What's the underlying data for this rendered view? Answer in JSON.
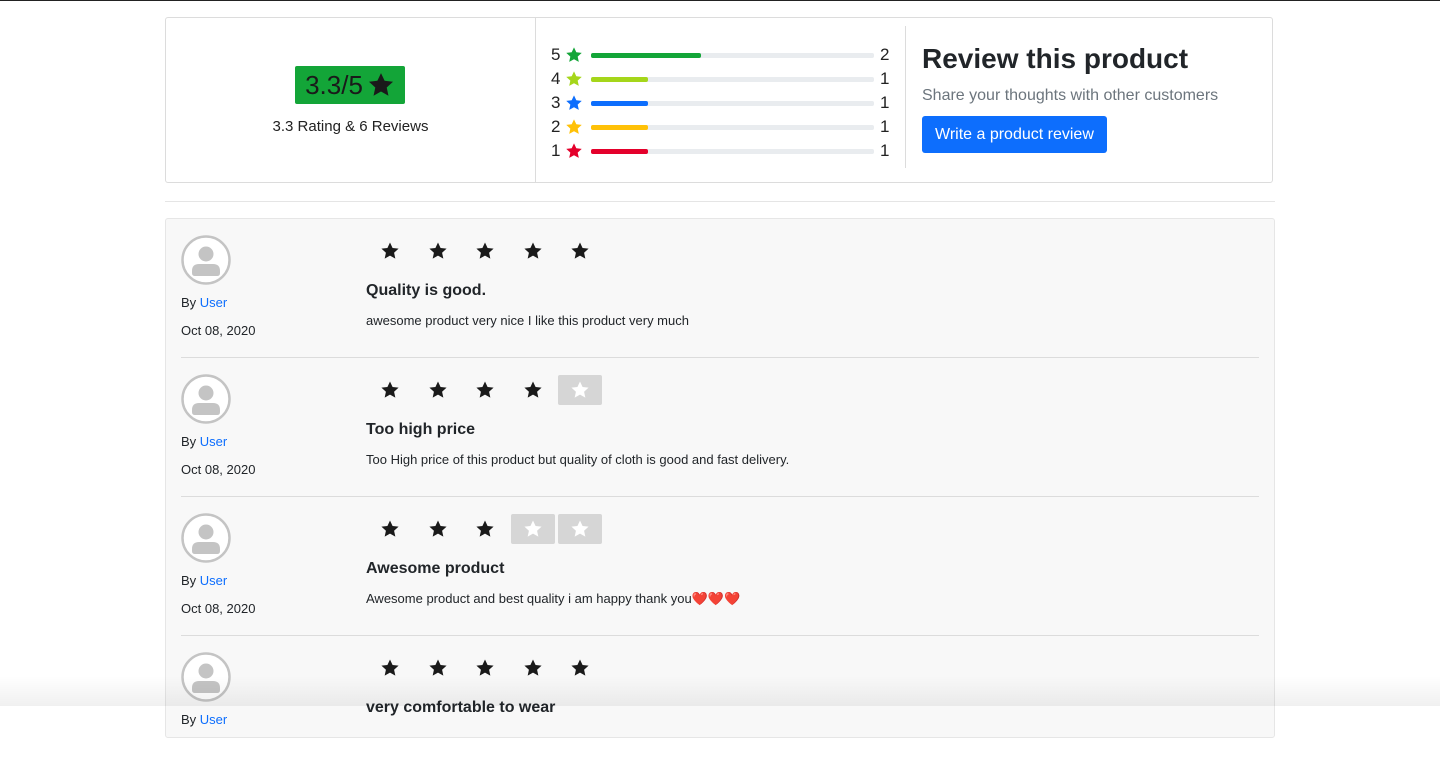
{
  "summary": {
    "score": "3.3/5",
    "caption": "3.3 Rating & 6 Reviews",
    "badge_color": "#13a538"
  },
  "distribution": [
    {
      "stars": "5",
      "count": "2",
      "fraction": 0.39,
      "color": "#13a538"
    },
    {
      "stars": "4",
      "count": "1",
      "fraction": 0.2,
      "color": "#a5d61a"
    },
    {
      "stars": "3",
      "count": "1",
      "fraction": 0.2,
      "color": "#0d6efd"
    },
    {
      "stars": "2",
      "count": "1",
      "fraction": 0.2,
      "color": "#ffc107"
    },
    {
      "stars": "1",
      "count": "1",
      "fraction": 0.2,
      "color": "#e4002b"
    }
  ],
  "cta": {
    "title": "Review this product",
    "subtitle": "Share your thoughts with other customers",
    "button": "Write a product review"
  },
  "reviews": [
    {
      "by": "By",
      "user": "User",
      "date": "Oct 08, 2020",
      "rating": 5,
      "title": "Quality is good.",
      "body": "awesome product very nice I like this product very much"
    },
    {
      "by": "By",
      "user": "User",
      "date": "Oct 08, 2020",
      "rating": 4,
      "title": "Too high price",
      "body": "Too High price of this product but quality of cloth is good and fast delivery."
    },
    {
      "by": "By",
      "user": "User",
      "date": "Oct 08, 2020",
      "rating": 3,
      "title": "Awesome product",
      "body": "Awesome product and best quality i am happy thank you❤️❤️❤️"
    },
    {
      "by": "By",
      "user": "User",
      "date": "",
      "rating": 5,
      "title": "very comfortable to wear",
      "body": ""
    }
  ]
}
